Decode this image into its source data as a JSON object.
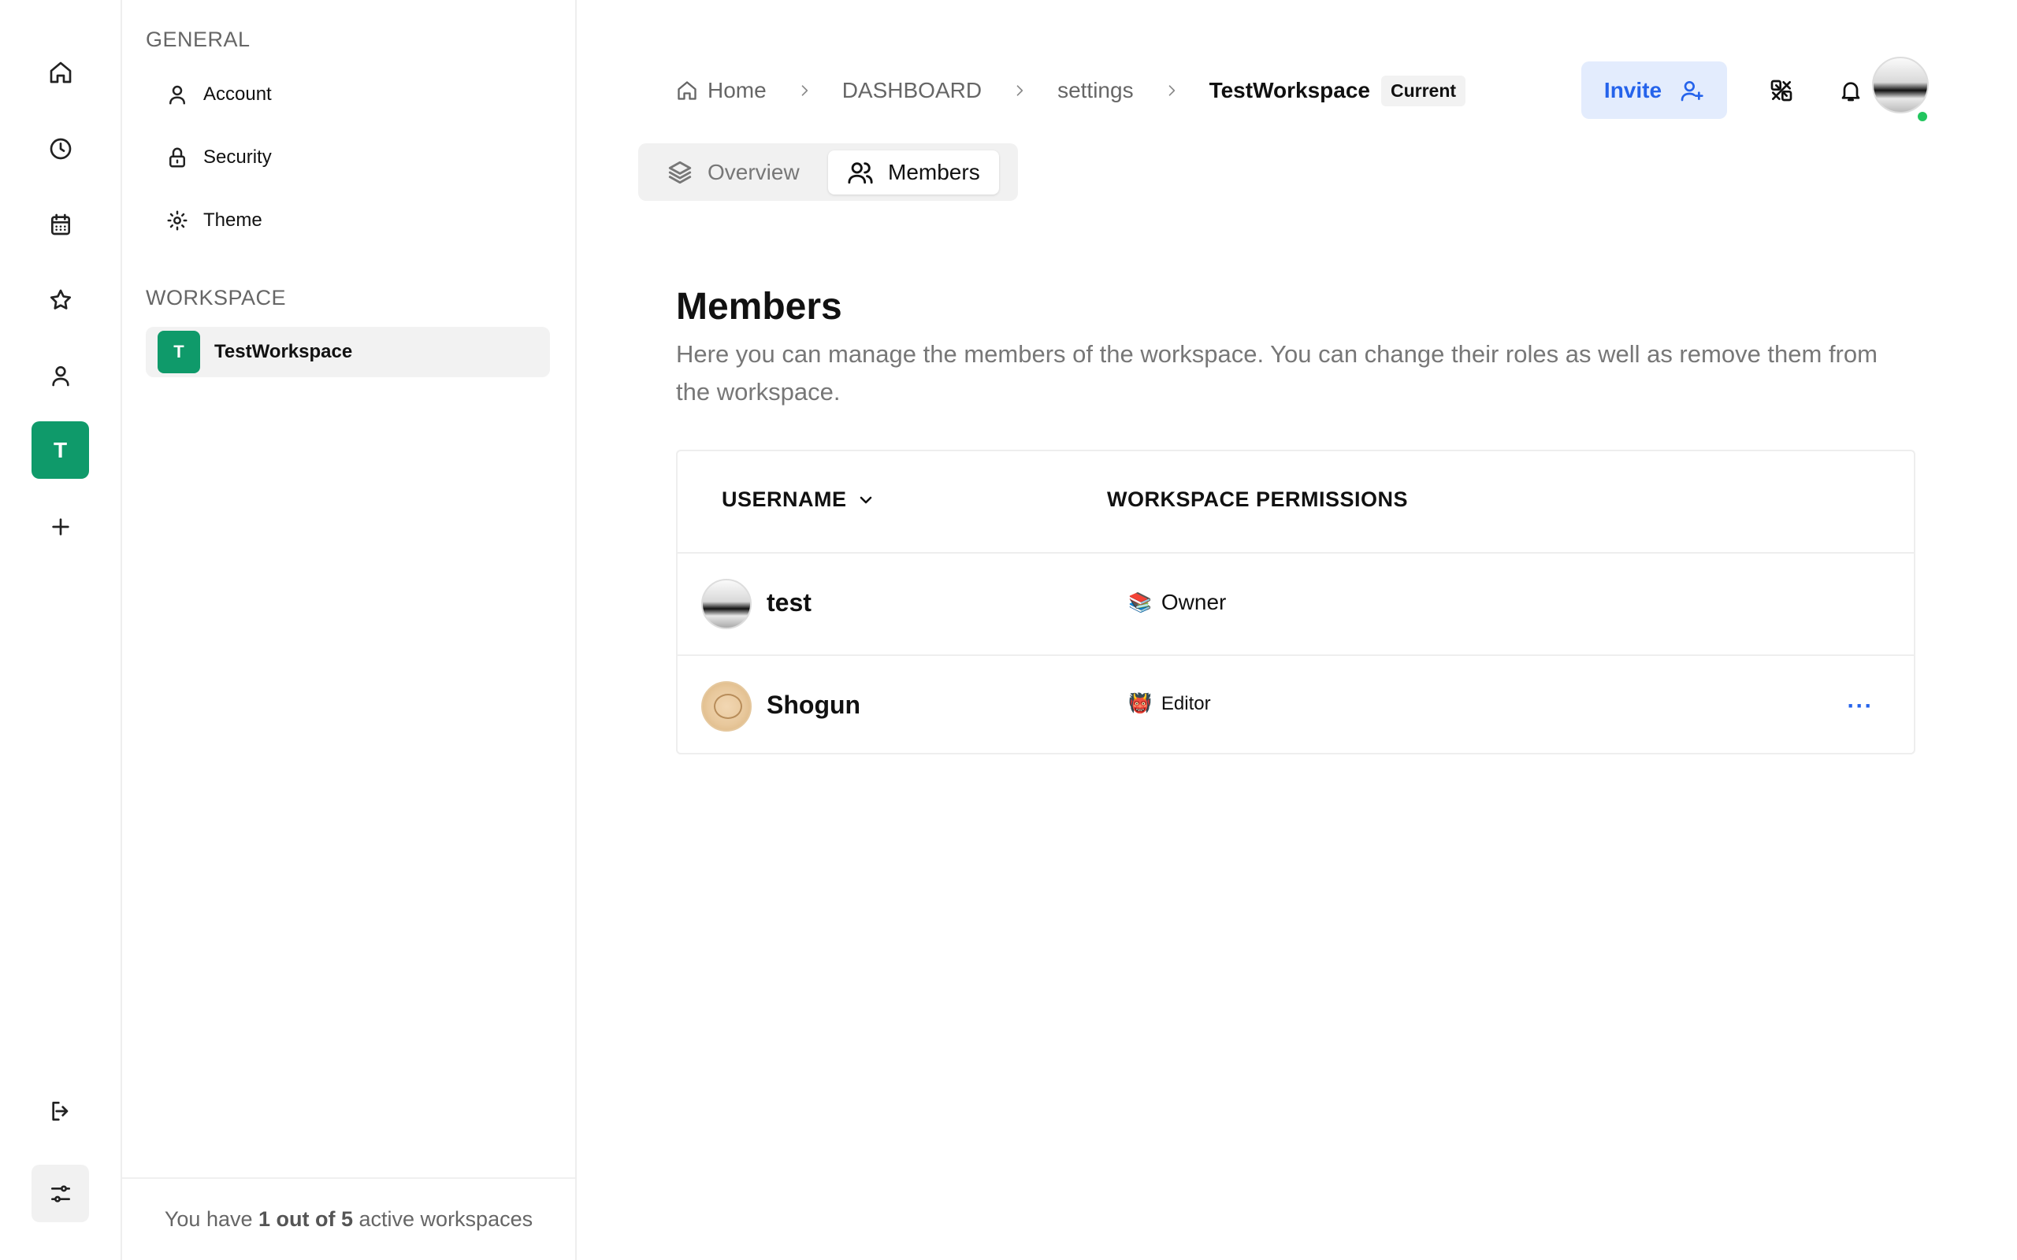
{
  "rail": {
    "workspace_initial": "T",
    "icons": [
      "home-icon",
      "clock-icon",
      "calendar-icon",
      "star-icon",
      "user-icon",
      "plus-icon",
      "logout-icon",
      "sliders-icon"
    ]
  },
  "sidebar": {
    "general_heading": "GENERAL",
    "items": [
      {
        "label": "Account",
        "icon": "user-icon"
      },
      {
        "label": "Security",
        "icon": "lock-icon"
      },
      {
        "label": "Theme",
        "icon": "sun-icon"
      }
    ],
    "workspace_heading": "WORKSPACE",
    "workspace": {
      "initial": "T",
      "name": "TestWorkspace"
    },
    "footer": {
      "prefix": "You have ",
      "count": "1 out of 5",
      "suffix": " active workspaces"
    }
  },
  "breadcrumb": {
    "items": [
      "Home",
      "DASHBOARD",
      "settings",
      "TestWorkspace"
    ],
    "current_badge": "Current"
  },
  "header": {
    "invite_label": "Invite"
  },
  "tabs": [
    {
      "label": "Overview",
      "active": false
    },
    {
      "label": "Members",
      "active": true
    }
  ],
  "page": {
    "title": "Members",
    "description": "Here you can manage the members of the workspace. You can change their roles as well as remove them from the workspace."
  },
  "table": {
    "columns": [
      "USERNAME",
      "WORKSPACE PERMISSIONS"
    ],
    "rows": [
      {
        "username": "test",
        "role_emoji": "📚",
        "role": "Owner"
      },
      {
        "username": "Shogun",
        "role_emoji": "👹",
        "role": "Editor",
        "menu": "···"
      }
    ]
  },
  "colors": {
    "accent": "#2563eb",
    "workspace_green": "#0f9a6a",
    "online": "#22c55e"
  }
}
